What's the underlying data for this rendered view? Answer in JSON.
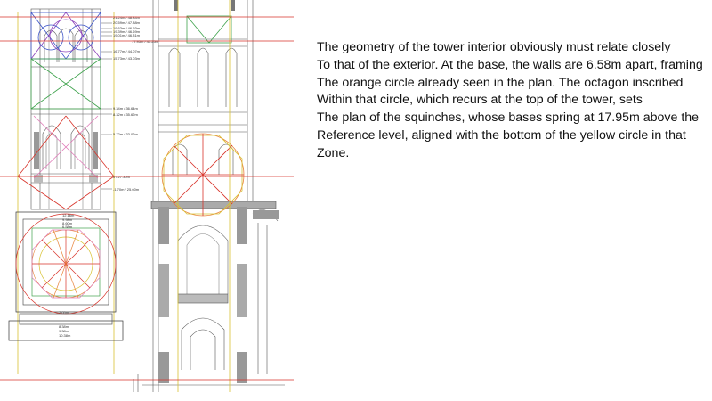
{
  "slide": {
    "paragraph_lines": [
      "The geometry of the tower interior obviously must relate closely",
      "To that of the exterior.  At the base, the walls are 6.58m apart, framing",
      "The orange circle already seen in the plan.  The octagon inscribed",
      "Within that circle, which recurs at the top of the tower, sets",
      "The plan of the squinches, whose bases spring at 17.95m above the",
      "Reference level, aligned with the bottom of the yellow circle in that",
      "Zone."
    ]
  },
  "drawing": {
    "elevation_labels": [
      "21.24m / 48.84m",
      "20.59m / 47.88m",
      "19.63m / 46.93m",
      "19.39m / 46.69m",
      "19.01m / 46.31m",
      "17.95m / 45.25m",
      "16.77m / 44.07m",
      "15.73m / 43.03m",
      "9.34m / 36.64m",
      "8.32m / 35.62m",
      "5.72m / 33.02m",
      "0 / 27.30m",
      "-1.70m / 25.60m"
    ],
    "plan_labels": [
      "12.16m",
      "9.98m",
      "8.60m",
      "6.58m",
      "7.05m",
      "8.38m",
      "9.38m",
      "10.38m"
    ],
    "colors": {
      "construction_red": "#d8332a",
      "orange_circle": "#e8833a",
      "yellow_circle": "#d8c232",
      "green": "#3fa34d",
      "blue": "#3a52c8",
      "purple": "#8a3fb8",
      "pink": "#e07ab8",
      "drawing_grey": "#555555"
    }
  }
}
